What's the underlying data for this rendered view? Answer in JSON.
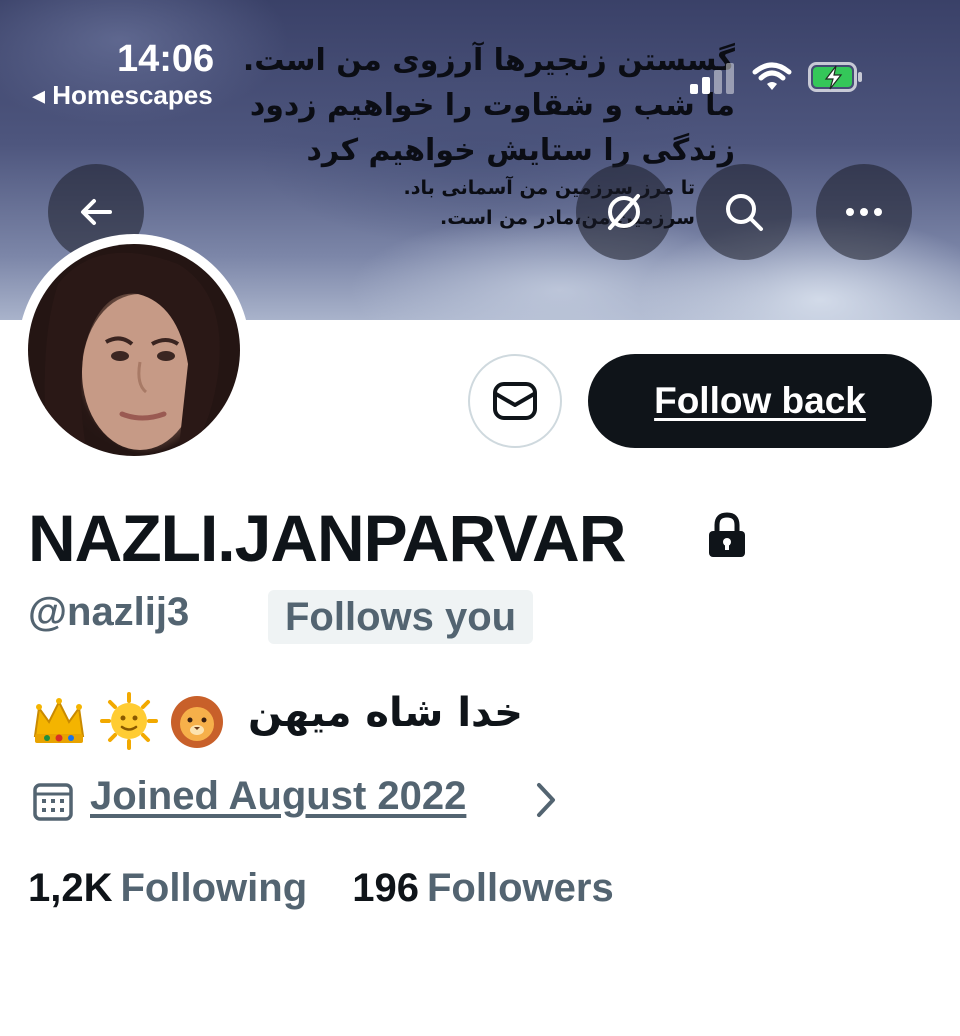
{
  "status_bar": {
    "time": "14:06",
    "back_app": "◂ Homescapes"
  },
  "banner": {
    "quote_lines": [
      "گسستن زنجیرها آرزوی من است.",
      "ما شب و شقاوت را خواهیم زدود",
      "زندگی را ستایش خواهیم کرد",
      "تا مرز سرزمین من آسمانی باد.",
      "سرزمین من،مادر من است."
    ]
  },
  "profile": {
    "display_name": "NAZLI.JANPARVAR",
    "handle": "@nazlij3",
    "follows_you": "Follows you",
    "bio": "خدا شاه میهن",
    "bio_emojis": [
      "lion-icon",
      "sun-face-icon",
      "crown-icon"
    ],
    "joined": "Joined August 2022",
    "following_count": "1,2K",
    "following_label": "Following",
    "followers_count": "196",
    "followers_label": "Followers"
  },
  "actions": {
    "follow_back": "Follow back"
  },
  "colors": {
    "primary_text": "#0f1419",
    "secondary_text": "#536471",
    "badge_bg": "#eff3f4",
    "battery_green": "#34c759"
  }
}
